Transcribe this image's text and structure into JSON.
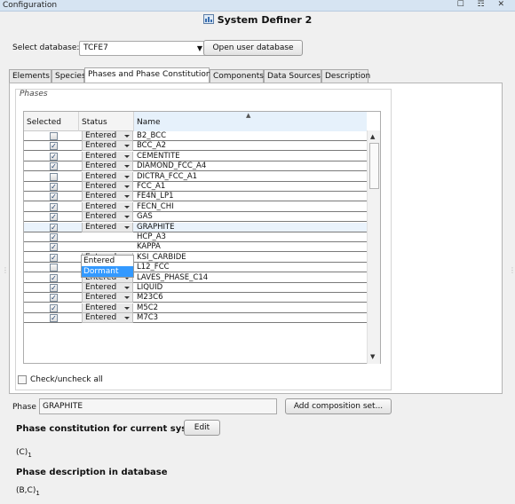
{
  "window": {
    "title": "Configuration",
    "controls": "☐ ☶ ✕"
  },
  "app_title": "System Definer 2",
  "database": {
    "label": "Select database:",
    "value": "TCFE7",
    "open_user_db_label": "Open user database"
  },
  "tabs": [
    {
      "label": "Elements",
      "active": false
    },
    {
      "label": "Species",
      "active": false
    },
    {
      "label": "Phases and Phase Constitution",
      "active": true
    },
    {
      "label": "Components",
      "active": false
    },
    {
      "label": "Data Sources",
      "active": false
    },
    {
      "label": "Description",
      "active": false
    }
  ],
  "phases": {
    "legend": "Phases",
    "columns": {
      "selected": "Selected",
      "status": "Status",
      "name": "Name"
    },
    "rows": [
      {
        "selected": false,
        "status": "Entered",
        "name": "B2_BCC"
      },
      {
        "selected": true,
        "status": "Entered",
        "name": "BCC_A2"
      },
      {
        "selected": true,
        "status": "Entered",
        "name": "CEMENTITE"
      },
      {
        "selected": true,
        "status": "Entered",
        "name": "DIAMOND_FCC_A4"
      },
      {
        "selected": false,
        "status": "Entered",
        "name": "DICTRA_FCC_A1"
      },
      {
        "selected": true,
        "status": "Entered",
        "name": "FCC_A1"
      },
      {
        "selected": true,
        "status": "Entered",
        "name": "FE4N_LP1"
      },
      {
        "selected": true,
        "status": "Entered",
        "name": "FECN_CHI"
      },
      {
        "selected": true,
        "status": "Entered",
        "name": "GAS"
      },
      {
        "selected": true,
        "status": "Entered",
        "name": "GRAPHITE"
      },
      {
        "selected": true,
        "status": "",
        "name": "HCP_A3"
      },
      {
        "selected": true,
        "status": "",
        "name": "KAPPA"
      },
      {
        "selected": true,
        "status": "Entered",
        "name": "KSI_CARBIDE"
      },
      {
        "selected": false,
        "status": "Entered",
        "name": "L12_FCC"
      },
      {
        "selected": true,
        "status": "Entered",
        "name": "LAVES_PHASE_C14"
      },
      {
        "selected": true,
        "status": "Entered",
        "name": "LIQUID"
      },
      {
        "selected": true,
        "status": "Entered",
        "name": "M23C6"
      },
      {
        "selected": true,
        "status": "Entered",
        "name": "M5C2"
      },
      {
        "selected": true,
        "status": "Entered",
        "name": "M7C3"
      }
    ],
    "dropdown_options": [
      "Entered",
      "Dormant"
    ],
    "dropdown_highlighted": "Dormant",
    "check_all_label": "Check/uncheck all"
  },
  "phase_field": {
    "label": "Phase",
    "value": "GRAPHITE",
    "add_composition_label": "Add composition set..."
  },
  "constitution": {
    "heading": "Phase constitution for current system",
    "edit_label": "Edit",
    "formula": "(C)",
    "formula_sub": "1"
  },
  "description": {
    "heading": "Phase description in database",
    "formula": "(B,C)",
    "formula_sub": "1"
  },
  "colors": {
    "selection": "#3399ff",
    "selected_row": "#eaf3fc",
    "header_sorted": "#e6f1fb"
  }
}
